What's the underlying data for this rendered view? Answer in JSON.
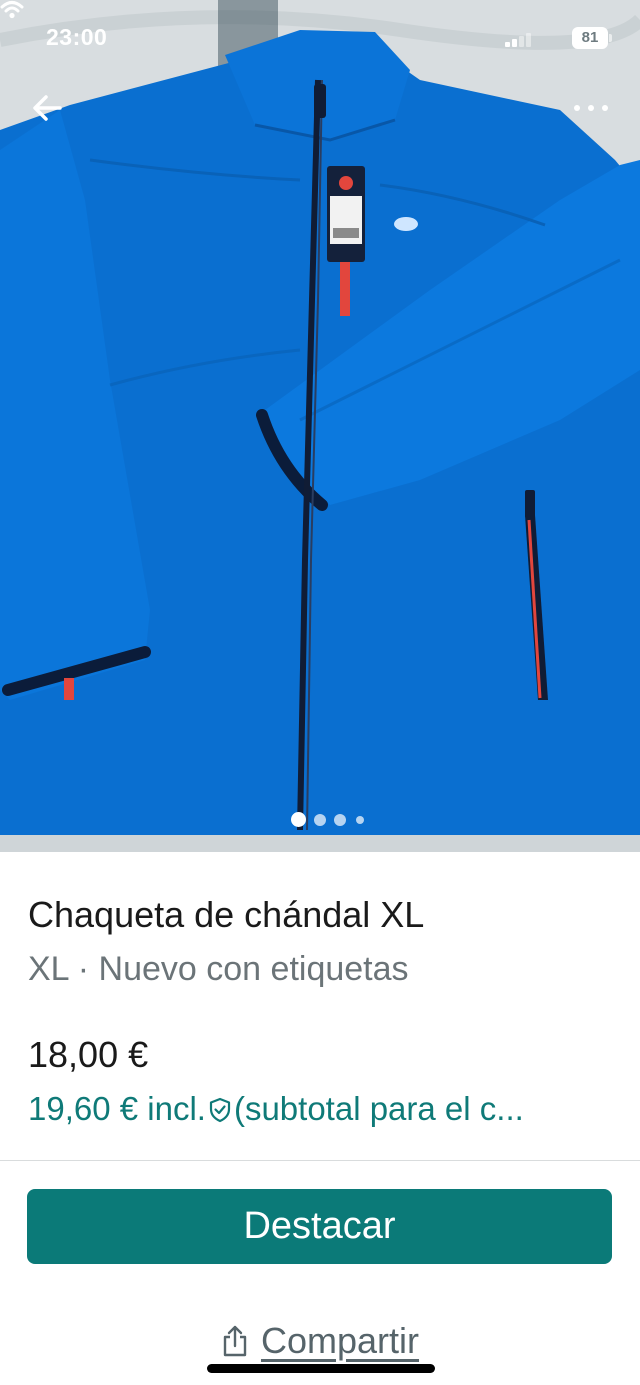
{
  "status_bar": {
    "time": "23:00",
    "battery": "81",
    "icons": [
      "signal-icon",
      "wifi-icon",
      "battery-icon"
    ]
  },
  "gallery": {
    "photo": "blue-track-jacket-photo",
    "current_index": 1,
    "total_images": 4
  },
  "navigation": {
    "back_icon": "arrow-left-icon",
    "more_icon": "more-horizontal-icon"
  },
  "product": {
    "title": "Chaqueta de chándal XL",
    "subtitle": "XL · Nuevo con etiquetas",
    "price": "18,00 €",
    "price_incl_amount": "19,60 € incl.",
    "price_incl_note": "(subtotal para el c...",
    "protection_icon": "shield-check-icon"
  },
  "actions": {
    "feature_button": "Destacar",
    "share_button": "Compartir",
    "share_icon": "share-icon"
  },
  "colors": {
    "accent": "#0b7a78",
    "jacket": "#0a6fd0"
  }
}
